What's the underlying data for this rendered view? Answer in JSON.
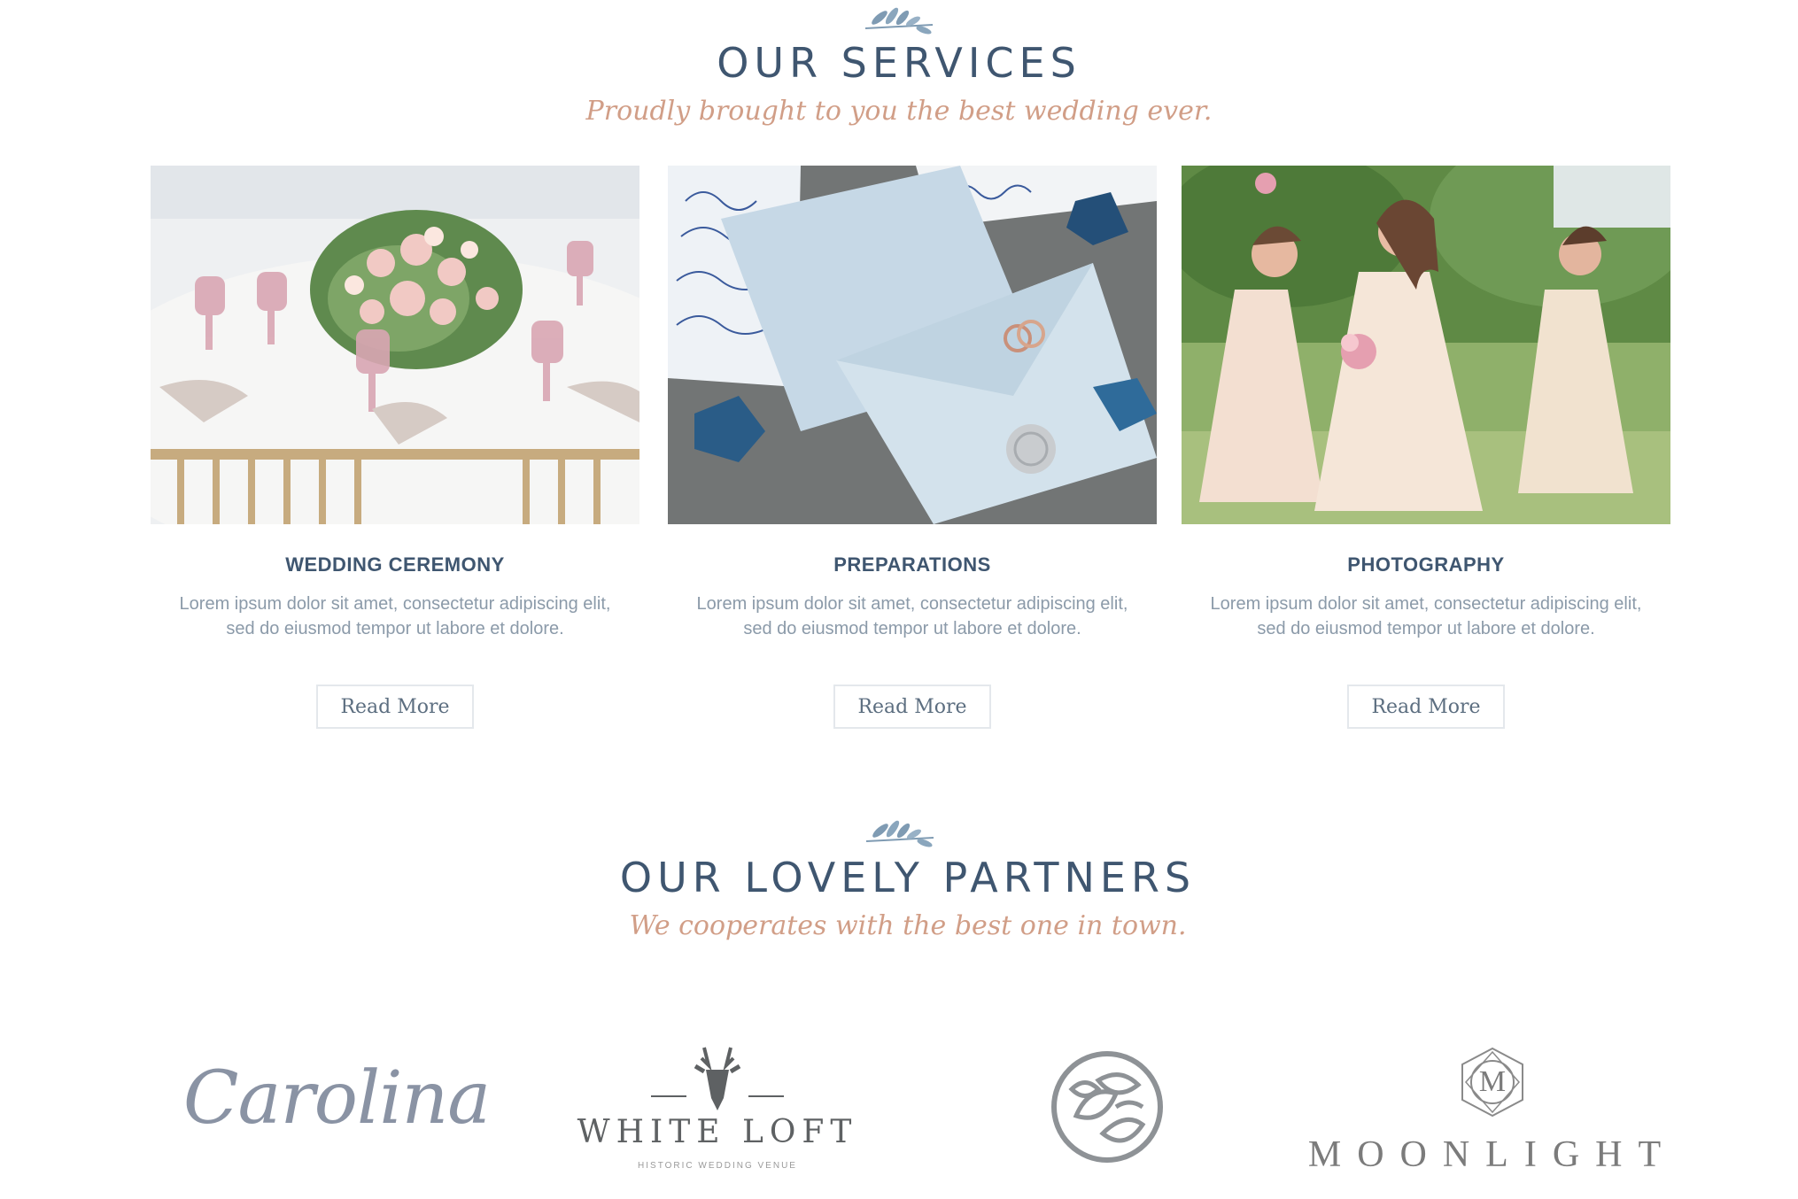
{
  "services": {
    "title": "OUR SERVICES",
    "subtitle": "Proudly brought to you the best wedding ever.",
    "items": [
      {
        "title": "WEDDING CEREMONY",
        "description": "Lorem ipsum dolor sit amet, consectetur adipiscing elit, sed do eiusmod tempor ut labore et dolore.",
        "button": "Read More"
      },
      {
        "title": "PREPARATIONS",
        "description": "Lorem ipsum dolor sit amet, consectetur adipiscing elit, sed do eiusmod tempor ut labore et dolore.",
        "button": "Read More"
      },
      {
        "title": "PHOTOGRAPHY",
        "description": "Lorem ipsum dolor sit amet, consectetur adipiscing elit, sed do eiusmod tempor ut labore et dolore.",
        "button": "Read More"
      }
    ]
  },
  "partners": {
    "title": "OUR LOVELY PARTNERS",
    "subtitle": "We cooperates with the best one in town.",
    "logos": [
      {
        "name": "Carolina"
      },
      {
        "name": "WHITE LOFT",
        "tagline": "HISTORIC WEDDING VENUE"
      },
      {
        "name": "leaf-circle-logo"
      },
      {
        "name": "MOONLIGHT",
        "monogram": "M"
      }
    ]
  },
  "colors": {
    "heading": "#3f5670",
    "accent": "#d19e87",
    "body_text": "#8b9aa9",
    "leaf_icon": "#7f9bb3"
  }
}
